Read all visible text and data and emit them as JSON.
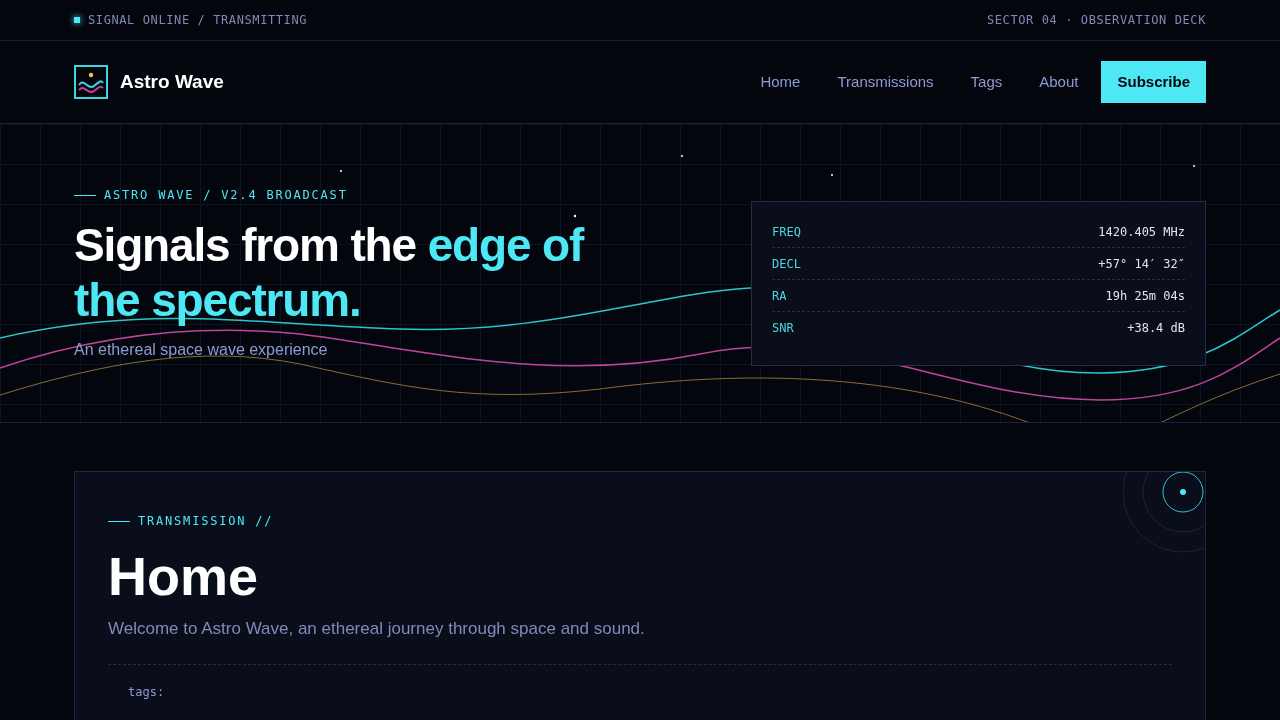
{
  "status_bar": {
    "left": "SIGNAL ONLINE / TRANSMITTING",
    "right": "SECTOR 04 · OBSERVATION DECK"
  },
  "header": {
    "brand": "Astro Wave",
    "nav": [
      {
        "label": "Home",
        "kind": "link"
      },
      {
        "label": "Transmissions",
        "kind": "link"
      },
      {
        "label": "Tags",
        "kind": "link"
      },
      {
        "label": "About",
        "kind": "link"
      },
      {
        "label": "Subscribe",
        "kind": "cta"
      }
    ]
  },
  "hero": {
    "eyebrow": "ASTRO WAVE / V2.4 BROADCAST",
    "headline": {
      "lead": "Signals from the",
      "accent": "edge of the spectrum."
    },
    "subtitle": "An ethereal space wave experience",
    "readout": [
      {
        "label": "FREQ",
        "value": "1420.405 MHz"
      },
      {
        "label": "DECL",
        "value": "+57° 14′ 32″"
      },
      {
        "label": "RA",
        "value": "19h 25m 04s"
      },
      {
        "label": "SNR",
        "value": "+38.4 dB"
      }
    ]
  },
  "card": {
    "eyebrow": "TRANSMISSION //",
    "title": "Home",
    "description": "Welcome to Astro Wave, an ethereal journey through space and sound.",
    "tags_label": "tags:"
  }
}
